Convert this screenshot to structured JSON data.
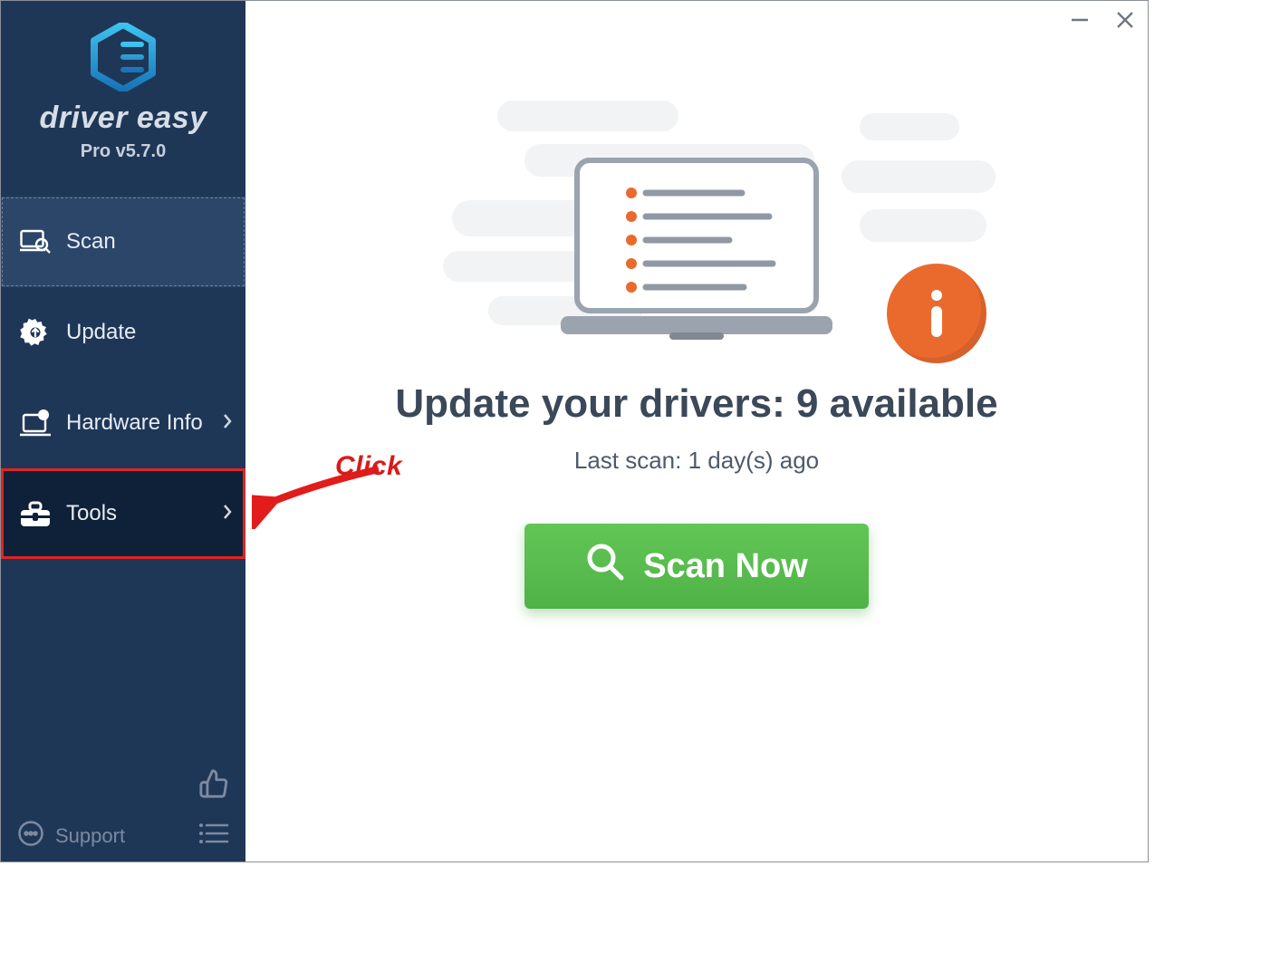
{
  "app": {
    "brand": "driver easy",
    "version": "Pro v5.7.0"
  },
  "sidebar": {
    "items": [
      {
        "label": "Scan"
      },
      {
        "label": "Update"
      },
      {
        "label": "Hardware Info"
      },
      {
        "label": "Tools"
      }
    ],
    "support_label": "Support"
  },
  "main": {
    "headline_prefix": "Update your drivers: ",
    "available_count": 9,
    "headline_suffix": " available",
    "last_scan_prefix": "Last scan: ",
    "last_scan_value": "1 day(s) ago",
    "scan_button": "Scan Now"
  },
  "annotation": {
    "label": "Click"
  },
  "colors": {
    "sidebar_bg": "#1f3757",
    "accent_blue": "#2aa3de",
    "scan_green": "#55bd4d",
    "info_orange": "#ea6a2e",
    "highlight_red": "#e02424",
    "headline": "#3b4859"
  }
}
